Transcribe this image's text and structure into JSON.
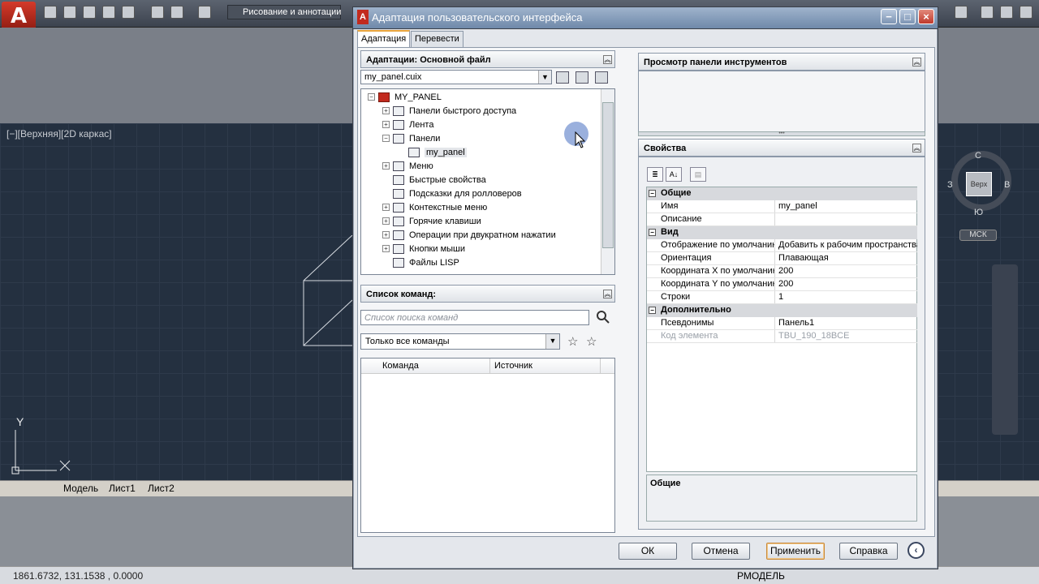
{
  "acad": {
    "logo": "A",
    "workspace": "Рисование и аннотации",
    "view_label": "[−][Верхняя][2D каркас]",
    "layout_tabs": [
      "Модель",
      "Лист1",
      "Лист2"
    ],
    "coords": "1861.6732, 131.1538 , 0.0000",
    "status_right": "РМОДЕЛЬ",
    "viewcube": {
      "face": "Верх",
      "n": "С",
      "s": "Ю",
      "w": "З",
      "e": "В"
    },
    "ucs": "МСК",
    "axis_y": "Y",
    "axis_x": "X"
  },
  "dialog": {
    "title": "Адаптация пользовательского интерфейса",
    "tabs": [
      "Адаптация",
      "Перевести"
    ],
    "customizations": {
      "header": "Адаптации: Основной файл",
      "file": "my_panel.cuix",
      "tree": [
        {
          "label": "MY_PANEL",
          "level": 0,
          "exp": "−"
        },
        {
          "label": "Панели быстрого доступа",
          "level": 1,
          "exp": "+"
        },
        {
          "label": "Лента",
          "level": 1,
          "exp": "+"
        },
        {
          "label": "Панели",
          "level": 1,
          "exp": "−"
        },
        {
          "label": "my_panel",
          "level": 2,
          "exp": ""
        },
        {
          "label": "Меню",
          "level": 1,
          "exp": "+"
        },
        {
          "label": "Быстрые свойства",
          "level": 1,
          "exp": ""
        },
        {
          "label": "Подсказки для ролловеров",
          "level": 1,
          "exp": ""
        },
        {
          "label": "Контекстные меню",
          "level": 1,
          "exp": "+"
        },
        {
          "label": "Горячие клавиши",
          "level": 1,
          "exp": "+"
        },
        {
          "label": "Операции при двукратном нажатии",
          "level": 1,
          "exp": "+"
        },
        {
          "label": "Кнопки мыши",
          "level": 1,
          "exp": "+"
        },
        {
          "label": "Файлы LISP",
          "level": 1,
          "exp": ""
        }
      ]
    },
    "commands": {
      "header": "Список команд:",
      "search_placeholder": "Список поиска команд",
      "filter": "Только все команды",
      "col_command": "Команда",
      "col_source": "Источник"
    },
    "preview": {
      "header": "Просмотр панели инструментов"
    },
    "properties": {
      "header": "Свойства",
      "categories": [
        {
          "name": "Общие",
          "rows": [
            {
              "key": "Имя",
              "value": "my_panel"
            },
            {
              "key": "Описание",
              "value": ""
            }
          ]
        },
        {
          "name": "Вид",
          "rows": [
            {
              "key": "Отображение по умолчанию",
              "value": "Добавить к рабочим пространствам"
            },
            {
              "key": "Ориентация",
              "value": "Плавающая"
            },
            {
              "key": "Координата X по умолчанию",
              "value": "200"
            },
            {
              "key": "Координата Y по умолчанию",
              "value": "200"
            },
            {
              "key": "Строки",
              "value": "1"
            }
          ]
        },
        {
          "name": "Дополнительно",
          "rows": [
            {
              "key": "Псевдонимы",
              "value": "Панель1"
            },
            {
              "key": "Код элемента",
              "value": "TBU_190_18BCE",
              "disabled": true
            }
          ]
        }
      ],
      "description_title": "Общие"
    },
    "buttons": {
      "ok": "ОК",
      "cancel": "Отмена",
      "apply": "Применить",
      "help": "Справка"
    }
  }
}
